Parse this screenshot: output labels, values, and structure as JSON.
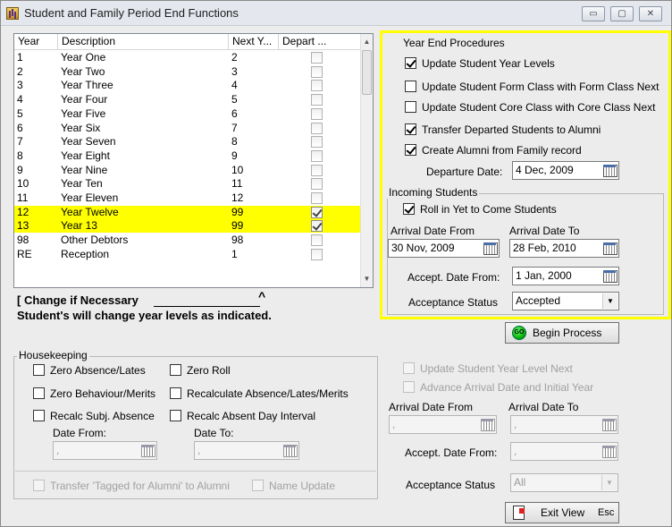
{
  "window": {
    "title": "Student and  Family Period End Functions",
    "minimize": "▭",
    "maximize": "▢",
    "close": "✕"
  },
  "list": {
    "headers": [
      "Year",
      "Description",
      "Next Y...",
      "Depart ..."
    ],
    "rows": [
      {
        "year": "1",
        "description": "Year One",
        "next": "2",
        "depart": false,
        "highlight": false
      },
      {
        "year": "2",
        "description": "Year Two",
        "next": "3",
        "depart": false,
        "highlight": false
      },
      {
        "year": "3",
        "description": "Year Three",
        "next": "4",
        "depart": false,
        "highlight": false
      },
      {
        "year": "4",
        "description": "Year Four",
        "next": "5",
        "depart": false,
        "highlight": false
      },
      {
        "year": "5",
        "description": "Year Five",
        "next": "6",
        "depart": false,
        "highlight": false
      },
      {
        "year": "6",
        "description": "Year Six",
        "next": "7",
        "depart": false,
        "highlight": false
      },
      {
        "year": "7",
        "description": "Year Seven",
        "next": "8",
        "depart": false,
        "highlight": false
      },
      {
        "year": "8",
        "description": "Year Eight",
        "next": "9",
        "depart": false,
        "highlight": false
      },
      {
        "year": "9",
        "description": "Year Nine",
        "next": "10",
        "depart": false,
        "highlight": false
      },
      {
        "year": "10",
        "description": "Year Ten",
        "next": "11",
        "depart": false,
        "highlight": false
      },
      {
        "year": "11",
        "description": "Year Eleven",
        "next": "12",
        "depart": false,
        "highlight": false
      },
      {
        "year": "12",
        "description": "Year Twelve",
        "next": "99",
        "depart": true,
        "highlight": true
      },
      {
        "year": "13",
        "description": "Year 13",
        "next": "99",
        "depart": true,
        "highlight": true
      },
      {
        "year": "98",
        "description": "Other Debtors",
        "next": "98",
        "depart": false,
        "highlight": false
      },
      {
        "year": "RE",
        "description": "Reception",
        "next": "1",
        "depart": false,
        "highlight": false
      }
    ]
  },
  "notes": {
    "change_label": "[ Change if Necessary",
    "change_caret": "^",
    "students_note": "Student's will change year levels as indicated."
  },
  "year_end": {
    "title": "Year End Procedures",
    "options": [
      {
        "label": "Update Student Year Levels",
        "checked": true
      },
      {
        "label": "Update Student Form Class with Form Class Next",
        "checked": false
      },
      {
        "label": "Update Student Core Class with Core Class Next",
        "checked": false
      },
      {
        "label": "Transfer Departed Students to Alumni",
        "checked": true
      },
      {
        "label": "Create Alumni from Family record",
        "checked": true
      }
    ],
    "departure_label": "Departure Date:",
    "departure_value": "4 Dec, 2009"
  },
  "incoming": {
    "title": "Incoming Students",
    "roll_in_label": "Roll in Yet to Come Students",
    "roll_in_checked": true,
    "arrival_from_label": "Arrival Date From",
    "arrival_from_value": "30 Nov, 2009",
    "arrival_to_label": "Arrival Date To",
    "arrival_to_value": "28 Feb, 2010",
    "accept_from_label": "Accept. Date  From:",
    "accept_from_value": "1 Jan, 2000",
    "acceptance_label": "Acceptance Status",
    "acceptance_value": "Accepted"
  },
  "begin_button": {
    "icon_text": "GO",
    "label": "Begin Process"
  },
  "housekeeping": {
    "title": "Housekeeping",
    "zero_absence": "Zero Absence/Lates",
    "zero_roll": "Zero Roll",
    "zero_behaviour": "Zero Behaviour/Merits",
    "recalc_absence": "Recalculate Absence/Lates/Merits",
    "recalc_subj": "Recalc Subj. Absence",
    "recalc_absent_day": "Recalc Absent Day Interval",
    "date_from_label": "Date From:",
    "date_from_value": " ,",
    "date_to_label": "Date To:",
    "date_to_value": " ,",
    "transfer_tagged": "Transfer 'Tagged for Alumni' to Alumni",
    "name_update": "Name Update"
  },
  "disabled_panel": {
    "update_next": "Update Student Year Level Next",
    "advance_arrival": "Advance Arrival Date and Initial Year",
    "arrival_from_label": "Arrival Date From",
    "arrival_from_value": " ,",
    "arrival_to_label": "Arrival Date To",
    "arrival_to_value": " ,",
    "accept_from_label": "Accept. Date  From:",
    "accept_from_value": " ,",
    "acceptance_label": "Acceptance Status",
    "acceptance_value": "All"
  },
  "exit_button": {
    "label": "Exit View",
    "shortcut": "Esc"
  }
}
